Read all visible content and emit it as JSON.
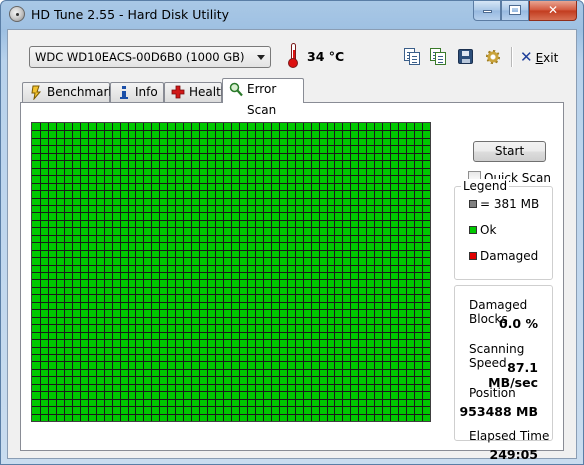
{
  "window": {
    "title": "HD Tune 2.55 - Hard Disk Utility",
    "app_icon": "hdtune-disk-icon",
    "controls": {
      "minimize": "minimize-icon",
      "maximize": "maximize-icon",
      "close": "close-icon"
    }
  },
  "toolbar": {
    "drive_selected": "WDC WD10EACS-00D6B0 (1000 GB)",
    "temperature": "34 °C",
    "temperature_icon": "thermometer-icon",
    "buttons": [
      {
        "name": "copy-text-icon"
      },
      {
        "name": "copy-screenshot-icon"
      },
      {
        "name": "save-icon"
      },
      {
        "name": "options-icon"
      }
    ],
    "exit_label": "Exit",
    "exit_prefix": "E",
    "exit_rest": "xit"
  },
  "tabs": [
    {
      "label": "Benchmark",
      "icon": "benchmark-icon",
      "active": false
    },
    {
      "label": "Info",
      "icon": "info-icon",
      "active": false
    },
    {
      "label": "Health",
      "icon": "health-cross-icon",
      "active": false
    },
    {
      "label": "Error Scan",
      "icon": "magnifier-icon",
      "active": true
    }
  ],
  "scan": {
    "grid": {
      "columns": 50,
      "rows": 40,
      "ok_color": "#00c800",
      "grid_line_color": "#1a1a1a"
    },
    "start_label": "Start",
    "quick_scan_label": "Quick Scan",
    "quick_scan_checked": false,
    "legend": {
      "title": "Legend",
      "items": [
        {
          "label": "= 381 MB",
          "color": "#808080"
        },
        {
          "label": "Ok",
          "color": "#00c800"
        },
        {
          "label": "Damaged",
          "color": "#e00000"
        }
      ]
    },
    "stats": {
      "damaged_blocks_label": "Damaged Blocks",
      "damaged_blocks_value": "0.0 %",
      "scanning_speed_label": "Scanning Speed",
      "scanning_speed_value": "87.1 MB/sec",
      "position_label": "Position",
      "position_value": "953488 MB",
      "elapsed_label": "Elapsed Time",
      "elapsed_value": "249:05"
    }
  },
  "colors": {
    "ok": "#00c800",
    "damaged": "#e00000",
    "block": "#808080",
    "close_button": "#c8452a"
  }
}
